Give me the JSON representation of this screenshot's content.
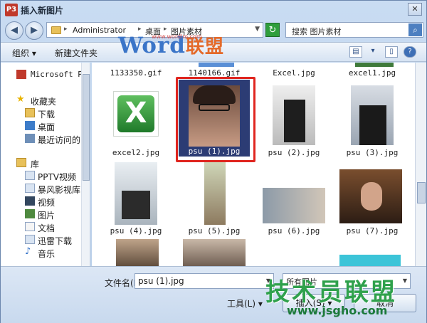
{
  "window": {
    "title": "插入新图片",
    "app_icon_text": "P3"
  },
  "address": {
    "crumbs": [
      "Administrator",
      "桌面",
      "图片素材"
    ]
  },
  "search": {
    "text": "搜索 图片素材"
  },
  "toolbar": {
    "organize": "组织",
    "new_folder": "新建文件夹"
  },
  "watermark": {
    "logo": "Word",
    "logo_cn": "联盟",
    "url": "www.wordlm.com"
  },
  "nav": {
    "items": [
      {
        "label": "Microsoft Po",
        "icon": "powerpoint-icon"
      },
      {
        "label": "收藏夹",
        "icon": "star-icon"
      },
      {
        "label": "下载",
        "icon": "download-folder-icon"
      },
      {
        "label": "桌面",
        "icon": "desktop-icon"
      },
      {
        "label": "最近访问的",
        "icon": "recent-places-icon"
      },
      {
        "label": "库",
        "icon": "library-icon"
      },
      {
        "label": "PPTV视频",
        "icon": "library-folder-icon"
      },
      {
        "label": "暴风影视库",
        "icon": "library-folder-icon"
      },
      {
        "label": "视频",
        "icon": "video-library-icon"
      },
      {
        "label": "图片",
        "icon": "picture-library-icon"
      },
      {
        "label": "文档",
        "icon": "document-library-icon"
      },
      {
        "label": "迅雷下载",
        "icon": "library-folder-icon"
      },
      {
        "label": "音乐",
        "icon": "music-library-icon"
      }
    ]
  },
  "files": [
    {
      "name": "1133350.gif"
    },
    {
      "name": "1140166.gif"
    },
    {
      "name": "Excel.jpg"
    },
    {
      "name": "excel1.jpg"
    },
    {
      "name": "excel2.jpg"
    },
    {
      "name": "psu (1).jpg"
    },
    {
      "name": "psu (2).jpg"
    },
    {
      "name": "psu (3).jpg"
    },
    {
      "name": "psu (4).jpg"
    },
    {
      "name": "psu (5).jpg"
    },
    {
      "name": "psu (6).jpg"
    },
    {
      "name": "psu (7).jpg"
    }
  ],
  "bottom": {
    "filename_label": "文件名(N):",
    "filename_value": "psu (1).jpg",
    "filetype_value": "所有图片",
    "tools_label": "工具(L)",
    "insert_label": "插入(S)",
    "cancel_label": "取消"
  },
  "site": {
    "mark": "技术员联盟",
    "url": "www.jsgho.com"
  },
  "colors": {
    "selection": "#2c3c74",
    "highlight_box": "#e0251f",
    "site_green": "#2fa14c"
  }
}
